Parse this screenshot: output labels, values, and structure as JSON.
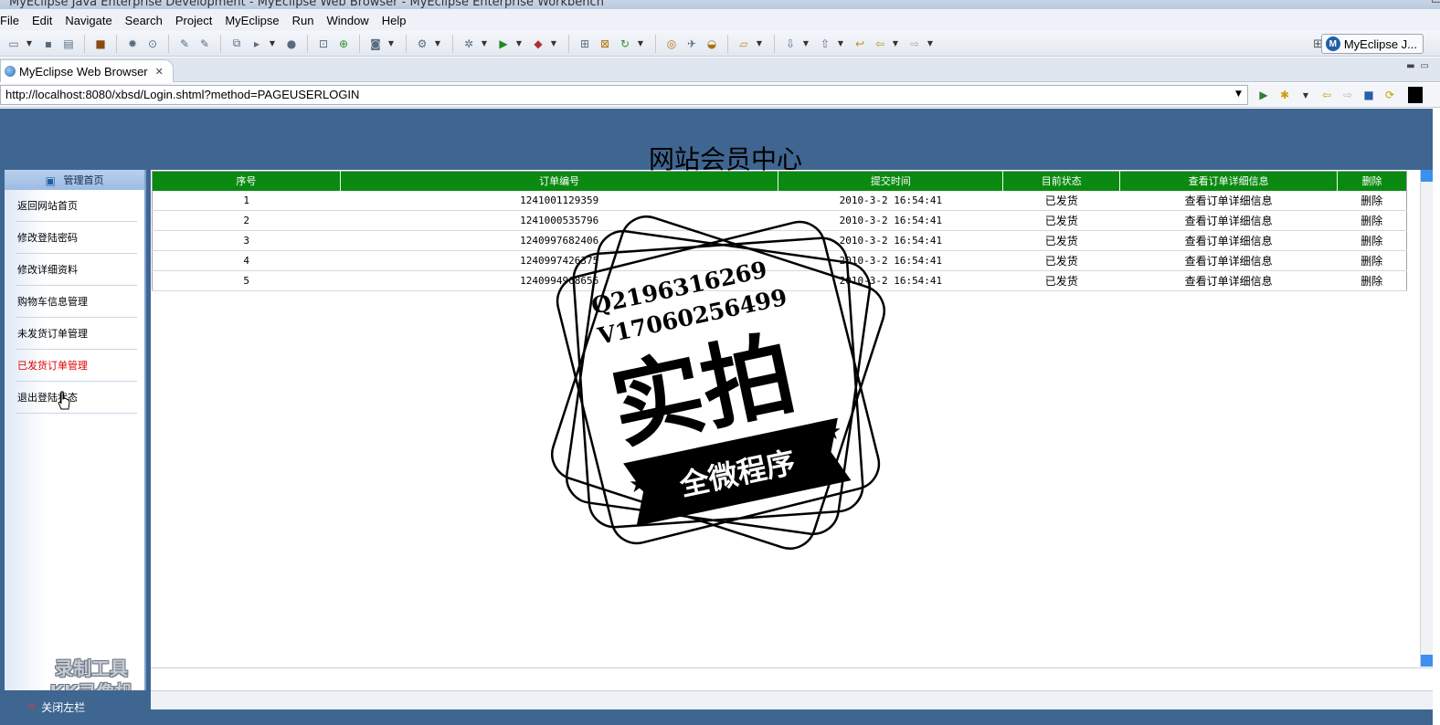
{
  "window": {
    "title": "MyEclipse Java Enterprise Development - MyEclipse Web Browser - MyEclipse Enterprise Workbench"
  },
  "menu": [
    "File",
    "Edit",
    "Navigate",
    "Search",
    "Project",
    "MyEclipse",
    "Run",
    "Window",
    "Help"
  ],
  "perspective": {
    "label": "MyEclipse J..."
  },
  "editor_tab": {
    "label": "MyEclipse Web Browser"
  },
  "address": {
    "url": "http://localhost:8080/xbsd/Login.shtml?method=PAGEUSERLOGIN"
  },
  "page": {
    "title": "网站会员中心",
    "sidebar": {
      "home": "管理首页",
      "items": [
        {
          "label": "返回网站首页"
        },
        {
          "label": "修改登陆密码"
        },
        {
          "label": "修改详细资料"
        },
        {
          "label": "购物车信息管理"
        },
        {
          "label": "未发货订单管理"
        },
        {
          "label": "已发货订单管理"
        },
        {
          "label": "退出登陆状态"
        }
      ]
    },
    "close_sidebar": "关闭左栏",
    "table": {
      "headers": [
        "序号",
        "订单编号",
        "提交时间",
        "目前状态",
        "查看订单详细信息",
        "删除"
      ],
      "rows": [
        {
          "seq": "1",
          "order_no": "1241001129359",
          "time": "2010-3-2 16:54:41",
          "status": "已发货",
          "detail": "查看订单详细信息",
          "delete": "删除"
        },
        {
          "seq": "2",
          "order_no": "1241000535796",
          "time": "2010-3-2 16:54:41",
          "status": "已发货",
          "detail": "查看订单详细信息",
          "delete": "删除"
        },
        {
          "seq": "3",
          "order_no": "1240997682406",
          "time": "2010-3-2 16:54:41",
          "status": "已发货",
          "detail": "查看订单详细信息",
          "delete": "删除"
        },
        {
          "seq": "4",
          "order_no": "1240997426375",
          "time": "2010-3-2 16:54:41",
          "status": "已发货",
          "detail": "查看订单详细信息",
          "delete": "删除"
        },
        {
          "seq": "5",
          "order_no": "1240994968656",
          "time": "2010-3-2 16:54:41",
          "status": "已发货",
          "detail": "查看订单详细信息",
          "delete": "删除"
        }
      ]
    }
  },
  "overlays": {
    "recorder_line1": "录制工具",
    "recorder_line2": "KK录像机",
    "stamp_contact1": "Q2196316269",
    "stamp_contact2": "V17060256499",
    "stamp_main": "实拍",
    "stamp_banner": "全微程序"
  }
}
